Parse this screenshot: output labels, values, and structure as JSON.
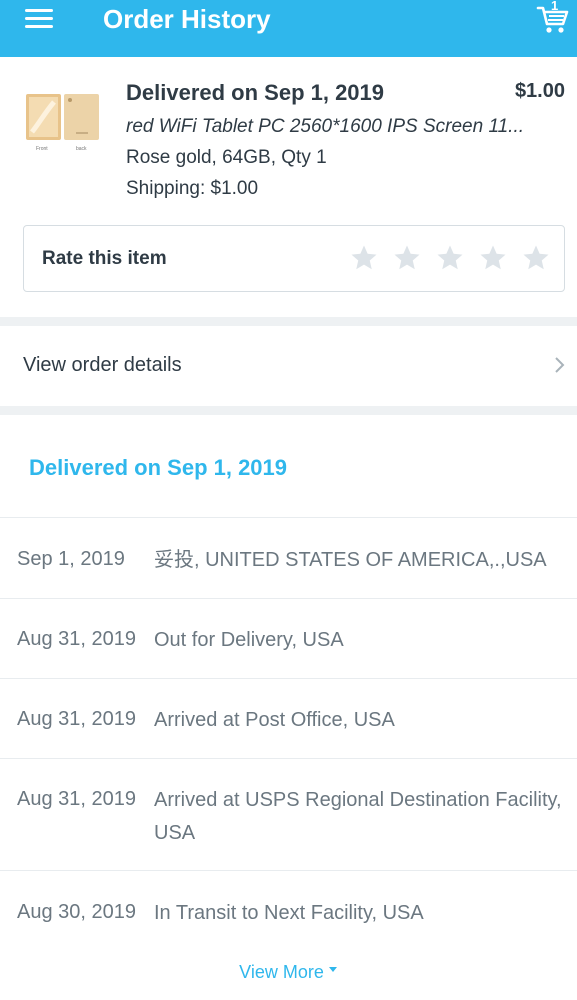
{
  "header": {
    "title": "Order History",
    "cart_count": "1",
    "background": "#2fb7ec"
  },
  "product": {
    "delivered_title": "Delivered on Sep 1, 2019",
    "price": "$1.00",
    "name": "red WiFi Tablet PC 2560*1600 IPS Screen 11...",
    "variant": "Rose gold, 64GB, Qty 1",
    "shipping": "Shipping: $1.00",
    "thumbnail_labels": [
      "Front",
      "back"
    ]
  },
  "rating": {
    "label": "Rate this item",
    "stars": 5,
    "filled": 0
  },
  "view_order": {
    "label": "View order details"
  },
  "tracking": {
    "heading": "Delivered on Sep 1, 2019",
    "events": [
      {
        "date": "Sep 1, 2019",
        "desc": "妥投, UNITED STATES OF AMERICA,.,USA"
      },
      {
        "date": "Aug 31, 2019",
        "desc": "Out for Delivery, USA"
      },
      {
        "date": "Aug 31, 2019",
        "desc": "Arrived at Post Office, USA"
      },
      {
        "date": "Aug 31, 2019",
        "desc": "Arrived at USPS Regional Destination Facility, USA"
      },
      {
        "date": "Aug 30, 2019",
        "desc": "In Transit to Next Facility, USA"
      }
    ],
    "view_more": "View More"
  },
  "colors": {
    "accent": "#2fb7ec",
    "text_dark": "#2f3b45",
    "text_muted": "#6b7780",
    "star_empty": "#dde3e8"
  }
}
